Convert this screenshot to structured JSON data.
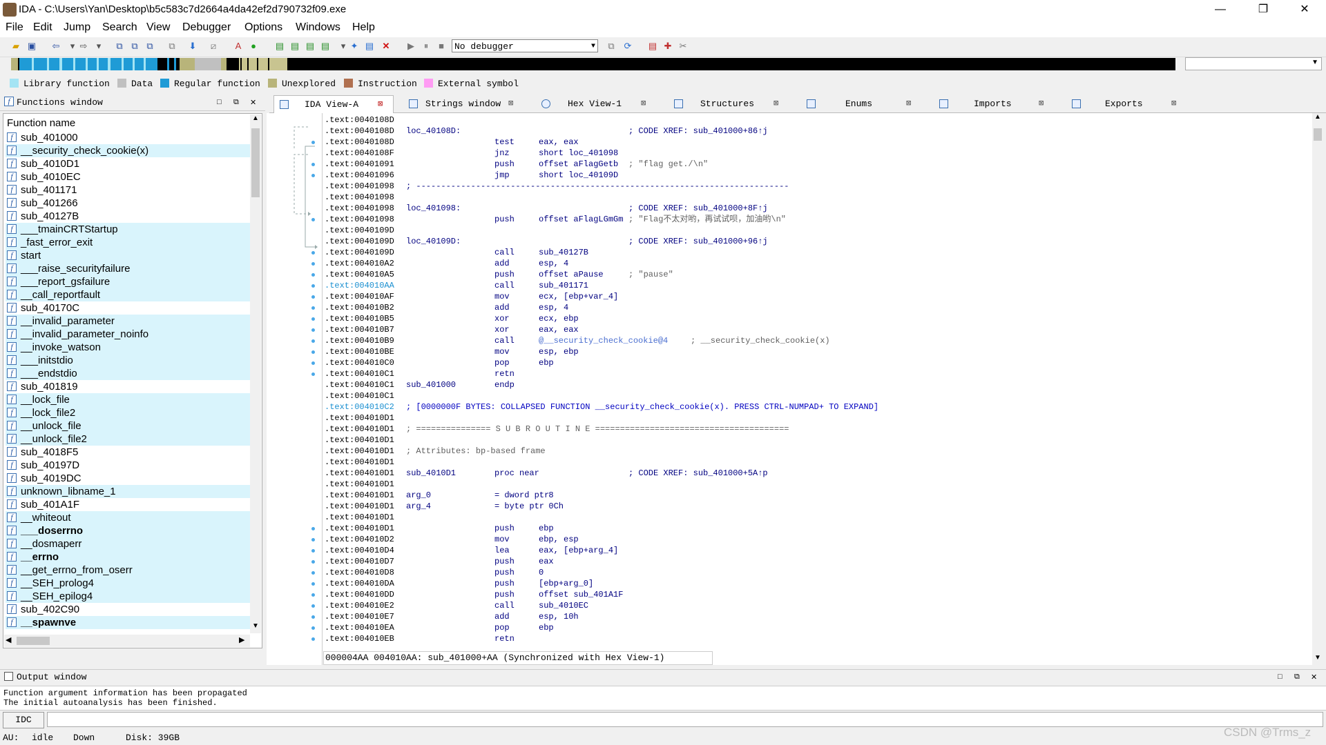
{
  "window": {
    "title": "IDA - C:\\Users\\Yan\\Desktop\\b5c583c7d2664a4da42ef2d790732f09.exe",
    "minimize": "—",
    "maximize": "❐",
    "close": "✕"
  },
  "menu": [
    "File",
    "Edit",
    "Jump",
    "Search",
    "View",
    "Debugger",
    "Options",
    "Windows",
    "Help"
  ],
  "toolbar": {
    "debugger_select": "No debugger"
  },
  "legend": [
    {
      "label": "Library function",
      "color": "#a4e4f4"
    },
    {
      "label": "Data",
      "color": "#c0c0c0"
    },
    {
      "label": "Regular function",
      "color": "#1f9bd6"
    },
    {
      "label": "Unexplored",
      "color": "#b8b47a"
    },
    {
      "label": "Instruction",
      "color": "#b07050"
    },
    {
      "label": "External symbol",
      "color": "#ff9cf4"
    }
  ],
  "functions_window": {
    "title": "Functions window",
    "header": "Function name",
    "items": [
      {
        "name": "sub_401000",
        "lib": false,
        "bold": false
      },
      {
        "name": "__security_check_cookie(x)",
        "lib": true,
        "bold": false
      },
      {
        "name": "sub_4010D1",
        "lib": false,
        "bold": false
      },
      {
        "name": "sub_4010EC",
        "lib": false,
        "bold": false
      },
      {
        "name": "sub_401171",
        "lib": false,
        "bold": false
      },
      {
        "name": "sub_401266",
        "lib": false,
        "bold": false
      },
      {
        "name": "sub_40127B",
        "lib": false,
        "bold": false
      },
      {
        "name": "___tmainCRTStartup",
        "lib": true,
        "bold": false
      },
      {
        "name": "_fast_error_exit",
        "lib": true,
        "bold": false
      },
      {
        "name": "start",
        "lib": true,
        "bold": false
      },
      {
        "name": "___raise_securityfailure",
        "lib": true,
        "bold": false
      },
      {
        "name": "___report_gsfailure",
        "lib": true,
        "bold": false
      },
      {
        "name": "__call_reportfault",
        "lib": true,
        "bold": false
      },
      {
        "name": "sub_40170C",
        "lib": false,
        "bold": false
      },
      {
        "name": "__invalid_parameter",
        "lib": true,
        "bold": false
      },
      {
        "name": "__invalid_parameter_noinfo",
        "lib": true,
        "bold": false
      },
      {
        "name": "__invoke_watson",
        "lib": true,
        "bold": false
      },
      {
        "name": "___initstdio",
        "lib": true,
        "bold": false
      },
      {
        "name": "___endstdio",
        "lib": true,
        "bold": false
      },
      {
        "name": "sub_401819",
        "lib": false,
        "bold": false
      },
      {
        "name": "__lock_file",
        "lib": true,
        "bold": false
      },
      {
        "name": "__lock_file2",
        "lib": true,
        "bold": false
      },
      {
        "name": "__unlock_file",
        "lib": true,
        "bold": false
      },
      {
        "name": "__unlock_file2",
        "lib": true,
        "bold": false
      },
      {
        "name": "sub_4018F5",
        "lib": false,
        "bold": false
      },
      {
        "name": "sub_40197D",
        "lib": false,
        "bold": false
      },
      {
        "name": "sub_4019DC",
        "lib": false,
        "bold": false
      },
      {
        "name": "unknown_libname_1",
        "lib": true,
        "bold": false
      },
      {
        "name": "sub_401A1F",
        "lib": false,
        "bold": false
      },
      {
        "name": "__whiteout",
        "lib": true,
        "bold": false
      },
      {
        "name": "___doserrno",
        "lib": true,
        "bold": true
      },
      {
        "name": "__dosmaperr",
        "lib": true,
        "bold": false
      },
      {
        "name": "__errno",
        "lib": true,
        "bold": true
      },
      {
        "name": "__get_errno_from_oserr",
        "lib": true,
        "bold": false
      },
      {
        "name": "__SEH_prolog4",
        "lib": true,
        "bold": false
      },
      {
        "name": "__SEH_epilog4",
        "lib": true,
        "bold": false
      },
      {
        "name": "sub_402C90",
        "lib": false,
        "bold": false
      },
      {
        "name": "__spawnve",
        "lib": true,
        "bold": true
      }
    ]
  },
  "tabs": [
    {
      "label": "IDA View-A",
      "active": true
    },
    {
      "label": "Strings window",
      "active": false
    },
    {
      "label": "Hex View-1",
      "active": false
    },
    {
      "label": "Structures",
      "active": false
    },
    {
      "label": "Enums",
      "active": false
    },
    {
      "label": "Imports",
      "active": false
    },
    {
      "label": "Exports",
      "active": false
    }
  ],
  "disasm": [
    {
      "addr": ".text:0040108D",
      "lbl": "",
      "mn": "",
      "op": "",
      "cm": "",
      "xref": ""
    },
    {
      "addr": ".text:0040108D",
      "lbl": "loc_40108D:",
      "mn": "",
      "op": "",
      "cm": "",
      "xref": "; CODE XREF: sub_401000+86↑j"
    },
    {
      "addr": ".text:0040108D",
      "lbl": "",
      "mn": "test",
      "op": "eax, eax",
      "cm": "",
      "xref": ""
    },
    {
      "addr": ".text:0040108F",
      "lbl": "",
      "mn": "jnz",
      "op": "short loc_401098",
      "cm": "",
      "xref": ""
    },
    {
      "addr": ".text:00401091",
      "lbl": "",
      "mn": "push",
      "op": "offset aFlagGetb",
      "cm": "; \"flag get./\\n\"",
      "xref": ""
    },
    {
      "addr": ".text:00401096",
      "lbl": "",
      "mn": "jmp",
      "op": "short loc_40109D",
      "cm": "",
      "xref": ""
    },
    {
      "addr": ".text:00401098",
      "lbl": "; ---------------------------------------------------------------------------",
      "mn": "",
      "op": "",
      "cm": "",
      "xref": ""
    },
    {
      "addr": ".text:00401098",
      "lbl": "",
      "mn": "",
      "op": "",
      "cm": "",
      "xref": ""
    },
    {
      "addr": ".text:00401098",
      "lbl": "loc_401098:",
      "mn": "",
      "op": "",
      "cm": "",
      "xref": "; CODE XREF: sub_401000+8F↑j"
    },
    {
      "addr": ".text:00401098",
      "lbl": "",
      "mn": "push",
      "op": "offset aFlagLGmGm",
      "cm": "; \"Flag不太对哟，再试试呗，加油哟\\n\"",
      "xref": ""
    },
    {
      "addr": ".text:0040109D",
      "lbl": "",
      "mn": "",
      "op": "",
      "cm": "",
      "xref": ""
    },
    {
      "addr": ".text:0040109D",
      "lbl": "loc_40109D:",
      "mn": "",
      "op": "",
      "cm": "",
      "xref": "; CODE XREF: sub_401000+96↑j"
    },
    {
      "addr": ".text:0040109D",
      "lbl": "",
      "mn": "call",
      "op": "sub_40127B",
      "cm": "",
      "xref": ""
    },
    {
      "addr": ".text:004010A2",
      "lbl": "",
      "mn": "add",
      "op": "esp, 4",
      "cm": "",
      "xref": ""
    },
    {
      "addr": ".text:004010A5",
      "lbl": "",
      "mn": "push",
      "op": "offset aPause",
      "cm": "; \"pause\"",
      "xref": ""
    },
    {
      "addr": ".text:004010AA",
      "lbl": "",
      "mn": "call",
      "op": "sub_401171",
      "cm": "",
      "xref": "",
      "hl": true
    },
    {
      "addr": ".text:004010AF",
      "lbl": "",
      "mn": "mov",
      "op": "ecx, [ebp+var_4]",
      "cm": "",
      "xref": ""
    },
    {
      "addr": ".text:004010B2",
      "lbl": "",
      "mn": "add",
      "op": "esp, 4",
      "cm": "",
      "xref": ""
    },
    {
      "addr": ".text:004010B5",
      "lbl": "",
      "mn": "xor",
      "op": "ecx, ebp",
      "cm": "",
      "xref": ""
    },
    {
      "addr": ".text:004010B7",
      "lbl": "",
      "mn": "xor",
      "op": "eax, eax",
      "cm": "",
      "xref": ""
    },
    {
      "addr": ".text:004010B9",
      "lbl": "",
      "mn": "call",
      "op": "@__security_check_cookie@4",
      "cm": "; __security_check_cookie(x)",
      "xref": ""
    },
    {
      "addr": ".text:004010BE",
      "lbl": "",
      "mn": "mov",
      "op": "esp, ebp",
      "cm": "",
      "xref": ""
    },
    {
      "addr": ".text:004010C0",
      "lbl": "",
      "mn": "pop",
      "op": "ebp",
      "cm": "",
      "xref": ""
    },
    {
      "addr": ".text:004010C1",
      "lbl": "",
      "mn": "retn",
      "op": "",
      "cm": "",
      "xref": ""
    },
    {
      "addr": ".text:004010C1",
      "lbl": "sub_401000",
      "mn": "endp",
      "op": "",
      "cm": "",
      "xref": ""
    },
    {
      "addr": ".text:004010C1",
      "lbl": "",
      "mn": "",
      "op": "",
      "cm": "",
      "xref": ""
    },
    {
      "addr": ".text:004010C2",
      "lbl": "; [0000000F BYTES: COLLAPSED FUNCTION __security_check_cookie(x). PRESS CTRL-NUMPAD+ TO EXPAND]",
      "mn": "",
      "op": "",
      "cm": "",
      "xref": "",
      "hl": true,
      "blue": true
    },
    {
      "addr": ".text:004010D1",
      "lbl": "",
      "mn": "",
      "op": "",
      "cm": "",
      "xref": ""
    },
    {
      "addr": ".text:004010D1",
      "lbl": "; =============== S U B R O U T I N E =======================================",
      "mn": "",
      "op": "",
      "cm": "",
      "xref": "",
      "grey": true
    },
    {
      "addr": ".text:004010D1",
      "lbl": "",
      "mn": "",
      "op": "",
      "cm": "",
      "xref": ""
    },
    {
      "addr": ".text:004010D1",
      "lbl": "; Attributes: bp-based frame",
      "mn": "",
      "op": "",
      "cm": "",
      "xref": "",
      "grey": true
    },
    {
      "addr": ".text:004010D1",
      "lbl": "",
      "mn": "",
      "op": "",
      "cm": "",
      "xref": ""
    },
    {
      "addr": ".text:004010D1",
      "lbl": "sub_4010D1",
      "mn": "proc near",
      "op": "",
      "cm": "",
      "xref": "; CODE XREF: sub_401000+5A↑p"
    },
    {
      "addr": ".text:004010D1",
      "lbl": "",
      "mn": "",
      "op": "",
      "cm": "",
      "xref": ""
    },
    {
      "addr": ".text:004010D1",
      "lbl": "arg_0",
      "mn": "= dword ptr",
      "op": "  8",
      "cm": "",
      "xref": ""
    },
    {
      "addr": ".text:004010D1",
      "lbl": "arg_4",
      "mn": "= byte ptr",
      "op": "  0Ch",
      "cm": "",
      "xref": ""
    },
    {
      "addr": ".text:004010D1",
      "lbl": "",
      "mn": "",
      "op": "",
      "cm": "",
      "xref": ""
    },
    {
      "addr": ".text:004010D1",
      "lbl": "",
      "mn": "push",
      "op": "ebp",
      "cm": "",
      "xref": ""
    },
    {
      "addr": ".text:004010D2",
      "lbl": "",
      "mn": "mov",
      "op": "ebp, esp",
      "cm": "",
      "xref": ""
    },
    {
      "addr": ".text:004010D4",
      "lbl": "",
      "mn": "lea",
      "op": "eax, [ebp+arg_4]",
      "cm": "",
      "xref": ""
    },
    {
      "addr": ".text:004010D7",
      "lbl": "",
      "mn": "push",
      "op": "eax",
      "cm": "",
      "xref": ""
    },
    {
      "addr": ".text:004010D8",
      "lbl": "",
      "mn": "push",
      "op": "0",
      "cm": "",
      "xref": ""
    },
    {
      "addr": ".text:004010DA",
      "lbl": "",
      "mn": "push",
      "op": "[ebp+arg_0]",
      "cm": "",
      "xref": ""
    },
    {
      "addr": ".text:004010DD",
      "lbl": "",
      "mn": "push",
      "op": "offset sub_401A1F",
      "cm": "",
      "xref": ""
    },
    {
      "addr": ".text:004010E2",
      "lbl": "",
      "mn": "call",
      "op": "sub_4010EC",
      "cm": "",
      "xref": ""
    },
    {
      "addr": ".text:004010E7",
      "lbl": "",
      "mn": "add",
      "op": "esp, 10h",
      "cm": "",
      "xref": ""
    },
    {
      "addr": ".text:004010EA",
      "lbl": "",
      "mn": "pop",
      "op": "ebp",
      "cm": "",
      "xref": ""
    },
    {
      "addr": ".text:004010EB",
      "lbl": "",
      "mn": "retn",
      "op": "",
      "cm": "",
      "xref": ""
    }
  ],
  "disasm_status": "000004AA 004010AA: sub_401000+AA (Synchronized with Hex View-1)",
  "output_window": {
    "title": "Output window",
    "lines": [
      "Function argument information has been propagated",
      "The initial autoanalysis has been finished."
    ]
  },
  "idc_button": "IDC",
  "statusbar": {
    "au_label": "AU:",
    "au_value": "idle",
    "direction": "Down",
    "disk": "Disk: 39GB"
  },
  "watermark": "CSDN @Trms_z"
}
